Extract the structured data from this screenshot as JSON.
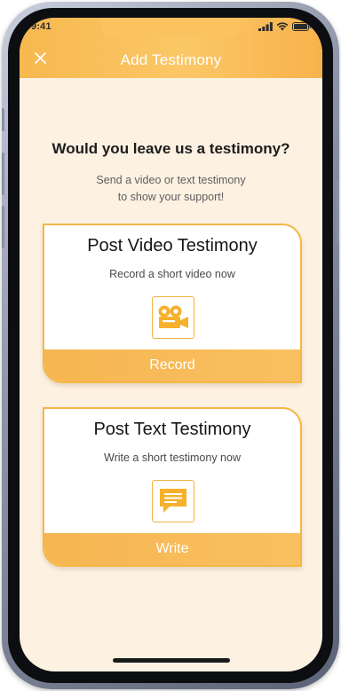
{
  "status_bar": {
    "time": "9:41",
    "signal_icon": "signal-bars-icon",
    "wifi_icon": "wifi-icon",
    "battery_icon": "battery-icon"
  },
  "header": {
    "title": "Add Testimony",
    "close_icon": "close-icon"
  },
  "prompt": {
    "question": "Would you leave us a testimony?",
    "subtitle_line1": "Send a video or text testimony",
    "subtitle_line2": "to show your support!"
  },
  "cards": [
    {
      "title": "Post Video Testimony",
      "description": "Record a short video now",
      "icon": "video-camera-icon",
      "action_label": "Record"
    },
    {
      "title": "Post Text Testimony",
      "description": "Write a short testimony now",
      "icon": "chat-message-icon",
      "action_label": "Write"
    }
  ],
  "colors": {
    "accent": "#f7b84f",
    "background": "#fdf1e2",
    "card_border": "#f4b746"
  }
}
